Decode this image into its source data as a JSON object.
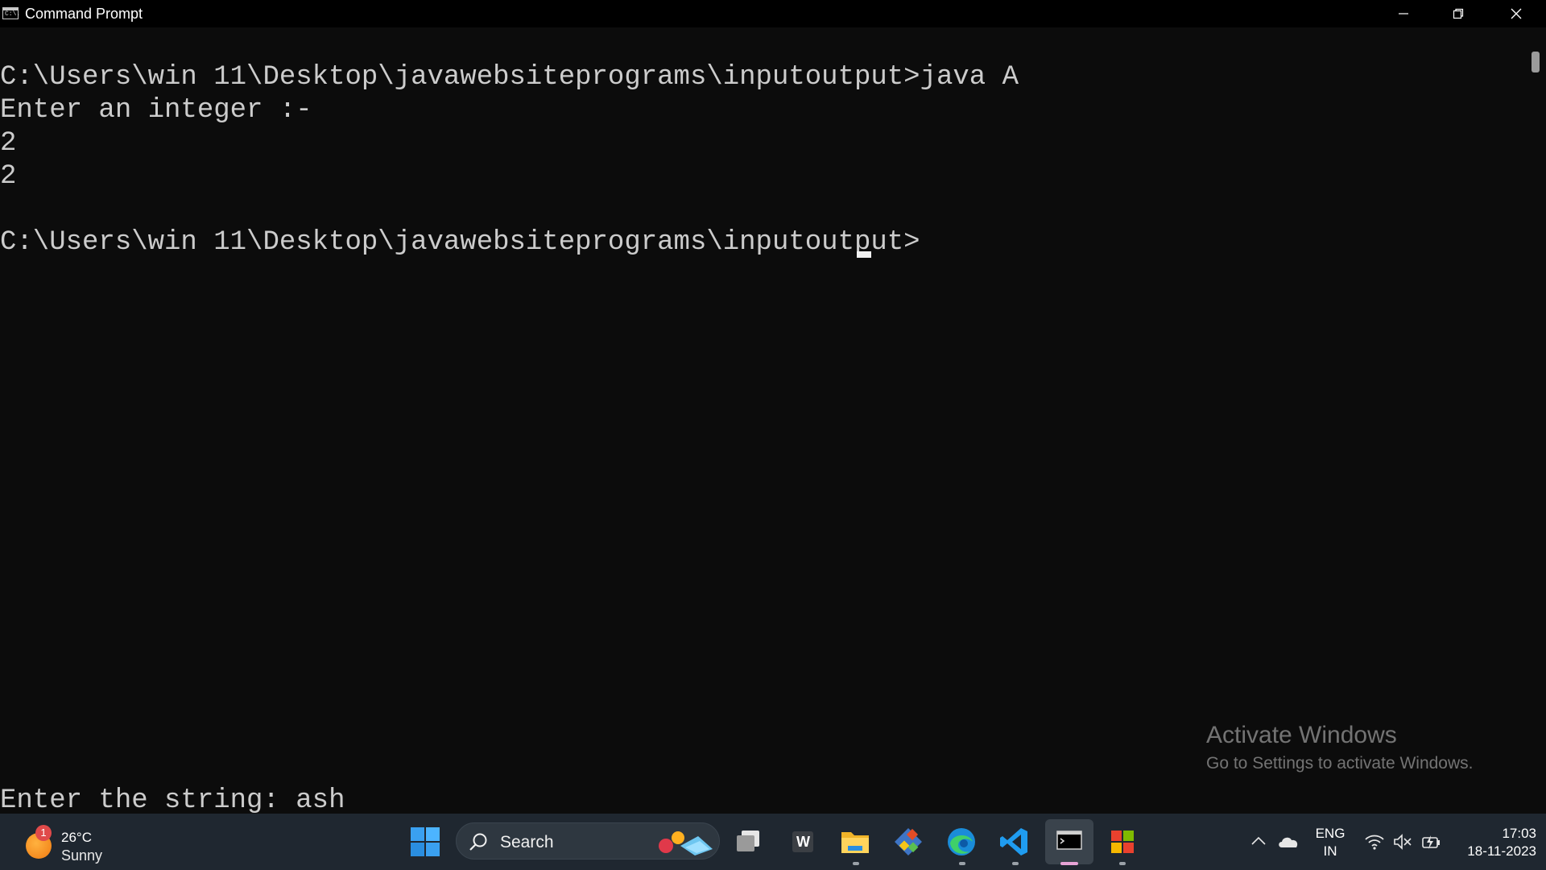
{
  "window": {
    "title": "Command Prompt",
    "icon_text": "C:\\."
  },
  "console": {
    "lines": [
      "",
      "C:\\Users\\win 11\\Desktop\\javawebsiteprograms\\inputoutput>java A",
      "Enter an integer :-",
      "2",
      "2",
      "",
      "C:\\Users\\win 11\\Desktop\\javawebsiteprograms\\inputoutput>"
    ],
    "bottom_line": "Enter the string: ash"
  },
  "watermark": {
    "title": "Activate Windows",
    "subtitle": "Go to Settings to activate Windows."
  },
  "taskbar": {
    "weather": {
      "badge": "1",
      "temperature": "26°C",
      "condition": "Sunny"
    },
    "search_label": "Search",
    "word_letter": "W",
    "language": {
      "line1": "ENG",
      "line2": "IN"
    },
    "clock": {
      "time": "17:03",
      "date": "18-11-2023"
    }
  },
  "colors": {
    "console_bg": "#0c0c0c",
    "console_text": "#cccccc",
    "taskbar_bg": "#1f2730",
    "active_indicator": "#e7a3d6"
  }
}
